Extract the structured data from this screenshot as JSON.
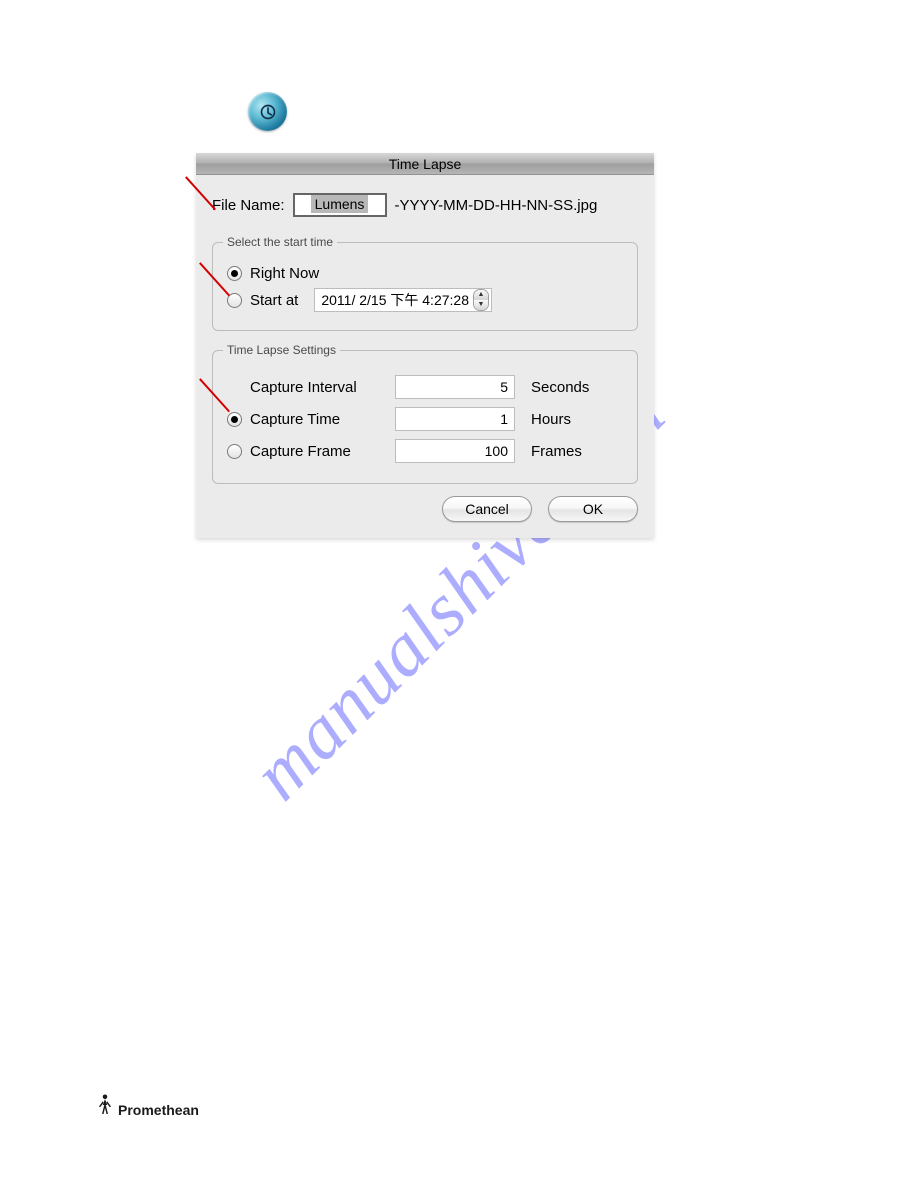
{
  "watermark": "manualshive.com",
  "dialog": {
    "title": "Time Lapse",
    "file_name_label": "File Name:",
    "file_name_value": "Lumens",
    "file_name_suffix": "-YYYY-MM-DD-HH-NN-SS.jpg"
  },
  "start_time": {
    "legend": "Select the start time",
    "right_now": "Right Now",
    "start_at": "Start at",
    "datetime": "2011/ 2/15 下午  4:27:28"
  },
  "settings": {
    "legend": "Time Lapse Settings",
    "interval_label": "Capture Interval",
    "interval_value": "5",
    "interval_unit": "Seconds",
    "time_label": "Capture Time",
    "time_value": "1",
    "time_unit": "Hours",
    "frame_label": "Capture Frame",
    "frame_value": "100",
    "frame_unit": "Frames"
  },
  "buttons": {
    "cancel": "Cancel",
    "ok": "OK"
  },
  "footer": {
    "brand": "Promethean"
  }
}
